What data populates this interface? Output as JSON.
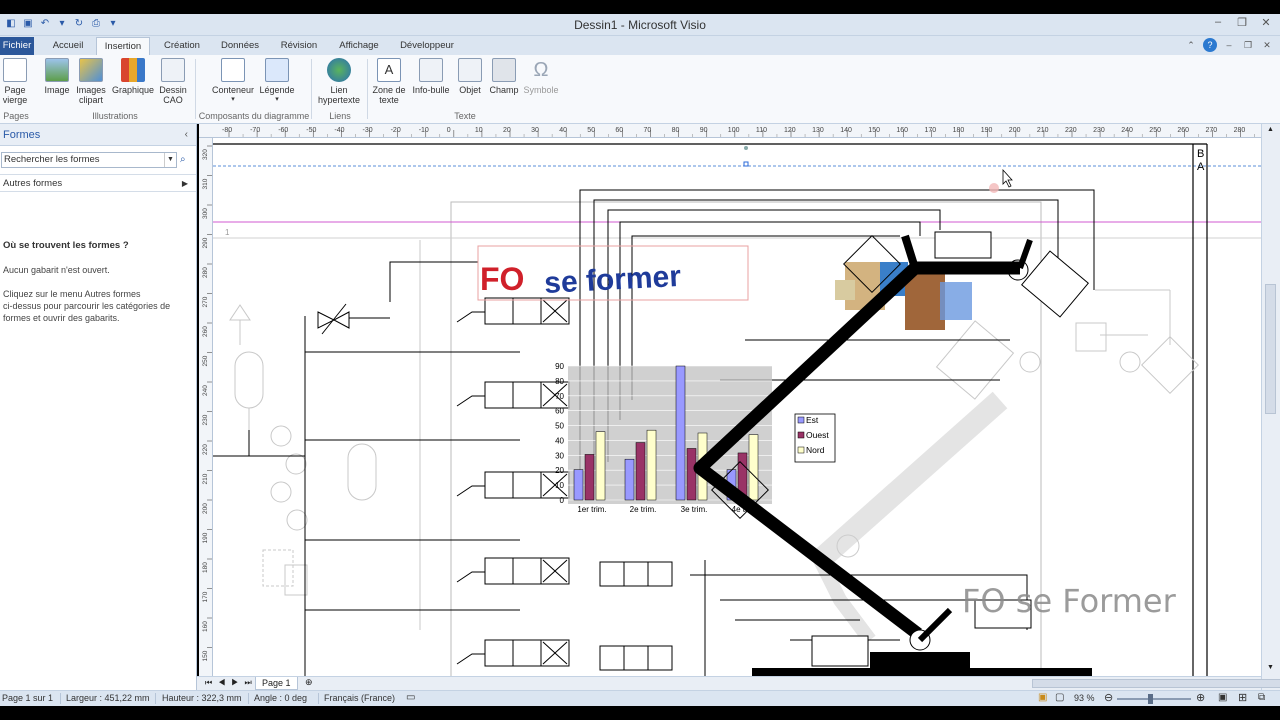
{
  "window": {
    "title": "Dessin1 - Microsoft Visio"
  },
  "tabs": {
    "file": "Fichier",
    "home": "Accueil",
    "insert": "Insertion",
    "design": "Création",
    "data": "Données",
    "review": "Révision",
    "view": "Affichage",
    "developer": "Développeur"
  },
  "ribbon": {
    "blank_page": "Page\nvierge",
    "image": "Image",
    "clipart": "Images\nclipart",
    "chart": "Graphique",
    "cad": "Dessin\nCAO",
    "container": "Conteneur",
    "callout": "Légende",
    "hyperlink": "Lien\nhypertexte",
    "textbox": "Zone de\ntexte",
    "tooltip": "Info-bulle",
    "object": "Objet",
    "field": "Champ",
    "symbol": "Symbole",
    "groups": {
      "pages": "Pages",
      "illustrations": "Illustrations",
      "diagram_parts": "Composants du diagramme",
      "links": "Liens",
      "text": "Texte"
    }
  },
  "shapes_panel": {
    "title": "Formes",
    "search_placeholder": "Rechercher les formes",
    "more_shapes": "Autres formes",
    "question": "Où se trouvent les formes ?",
    "no_stencil": "Aucun gabarit n'est ouvert.",
    "help_line1": "Cliquez sur le menu Autres formes",
    "help_line2": "ci-dessus pour parcourir les catégories de",
    "help_line3": "formes et ouvrir des gabarits."
  },
  "ruler": {
    "top_labels": [
      "-80",
      "-70",
      "-60",
      "-50",
      "-40",
      "-30",
      "-20",
      "-10",
      "0",
      "10",
      "20",
      "30",
      "40",
      "50",
      "60",
      "70",
      "80",
      "90",
      "100",
      "110",
      "120",
      "130",
      "140",
      "150",
      "160",
      "170",
      "180",
      "190",
      "200",
      "210",
      "220",
      "230",
      "240",
      "250",
      "260",
      "270",
      "280"
    ],
    "left_labels": [
      "320",
      "310",
      "300",
      "290",
      "280",
      "270",
      "260",
      "250",
      "240",
      "230",
      "220",
      "210",
      "200",
      "190",
      "180",
      "170",
      "160",
      "150"
    ]
  },
  "drawing": {
    "logo_left": "FO",
    "logo_right": "se former",
    "watermark": "FO se Former",
    "page_marker": "1",
    "border_letters": [
      "B",
      "A"
    ]
  },
  "chart_data": {
    "type": "bar",
    "categories": [
      "1er trim.",
      "2e trim.",
      "3e trim.",
      "4e trim."
    ],
    "series": [
      {
        "name": "Est",
        "values": [
          20.4,
          27.4,
          90,
          20.4
        ],
        "color": "#9999ff"
      },
      {
        "name": "Ouest",
        "values": [
          30.6,
          38.6,
          34.6,
          31.6
        ],
        "color": "#993366"
      },
      {
        "name": "Nord",
        "values": [
          45.9,
          46.9,
          45,
          43.9
        ],
        "color": "#ffffcc"
      }
    ],
    "yticks": [
      "0",
      "10",
      "20",
      "30",
      "40",
      "50",
      "60",
      "70",
      "80",
      "90"
    ],
    "ylim": [
      0,
      90
    ],
    "legend": "right"
  },
  "pagebar": {
    "page_tab": "Page 1"
  },
  "status": {
    "page": "Page 1 sur 1",
    "width": "Largeur : 451,22 mm",
    "height": "Hauteur : 322,3 mm",
    "angle": "Angle : 0 deg",
    "language": "Français (France)",
    "zoom": "93 %"
  }
}
